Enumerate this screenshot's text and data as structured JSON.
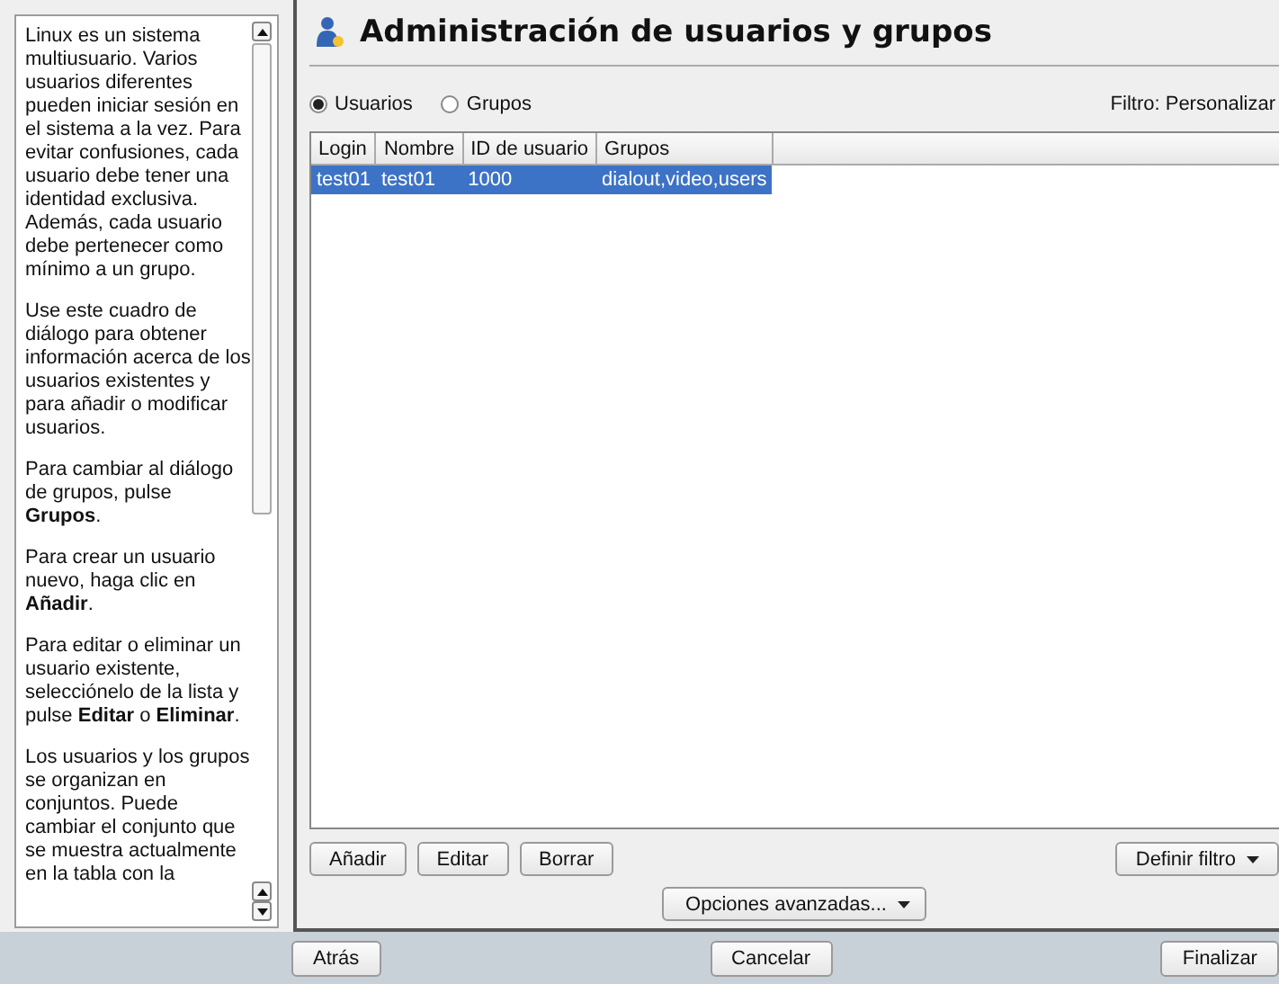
{
  "help": {
    "paragraphs": [
      "Linux es un sistema multiusuario. Varios usuarios diferentes pueden iniciar sesión en el sistema a la vez. Para evitar confusiones, cada usuario debe tener una identidad exclusiva. Además, cada usuario debe pertenecer como mínimo a un grupo.",
      "Use este cuadro de diálogo para obtener información acerca de los usuarios existentes y para añadir o modificar usuarios.",
      "Para cambiar al diálogo de grupos, pulse **Grupos**.",
      "Para crear un usuario nuevo, haga clic en **Añadir**.",
      "Para editar o eliminar un usuario existente, selecciónelo de la lista y pulse **Editar** o **Eliminar**.",
      "Los usuarios y los grupos se organizan en conjuntos. Puede cambiar el conjunto que se muestra actualmente en la tabla con la"
    ]
  },
  "header": {
    "title": "Administración de usuarios y grupos"
  },
  "view_options": [
    {
      "label": "Usuarios",
      "selected": true
    },
    {
      "label": "Grupos",
      "selected": false
    }
  ],
  "filter_label": "Filtro: Personalizar",
  "table": {
    "columns": [
      "Login",
      "Nombre",
      "ID de usuario",
      "Grupos"
    ],
    "rows": [
      {
        "cells": [
          "test01",
          "test01",
          "1000",
          "dialout,video,users"
        ],
        "selected": true
      }
    ]
  },
  "table_buttons": [
    "Añadir",
    "Editar",
    "Borrar"
  ],
  "filter_button": "Definir filtro",
  "advanced_button": "Opciones avanzadas...",
  "footer_buttons": [
    "Atrás",
    "Cancelar",
    "Finalizar"
  ]
}
